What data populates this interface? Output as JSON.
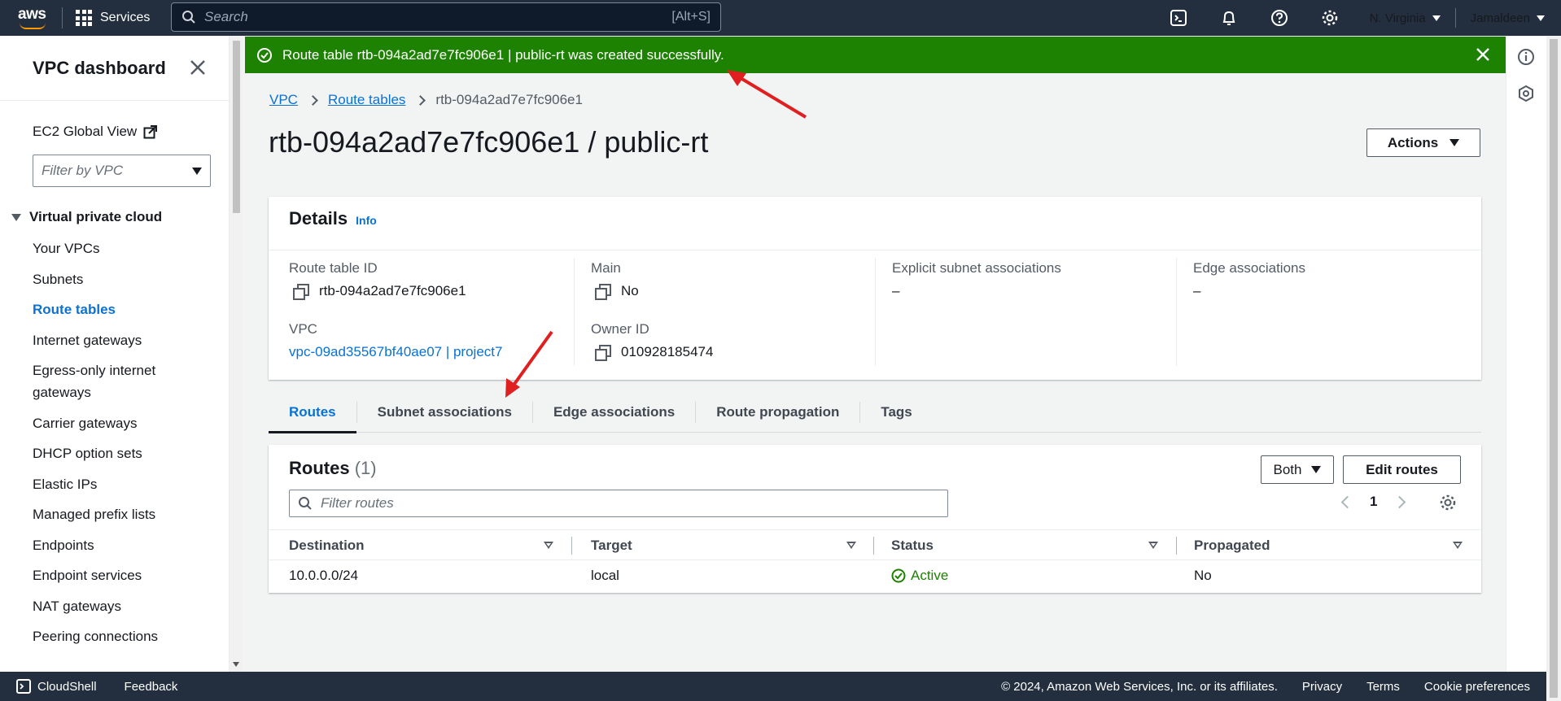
{
  "topnav": {
    "logo": "aws",
    "services_label": "Services",
    "search_placeholder": "Search",
    "search_shortcut": "[Alt+S]",
    "region": "N. Virginia",
    "user": "Jamaldeen",
    "icons": [
      "cloudshell-icon",
      "bell-icon",
      "help-icon",
      "gear-icon"
    ]
  },
  "sidebar": {
    "title": "VPC dashboard",
    "ec2_global_view": "EC2 Global View",
    "filter_placeholder": "Filter by VPC",
    "section": "Virtual private cloud",
    "items": [
      {
        "label": "Your VPCs"
      },
      {
        "label": "Subnets"
      },
      {
        "label": "Route tables",
        "active": true
      },
      {
        "label": "Internet gateways"
      },
      {
        "label": "Egress-only internet gateways"
      },
      {
        "label": "Carrier gateways"
      },
      {
        "label": "DHCP option sets"
      },
      {
        "label": "Elastic IPs"
      },
      {
        "label": "Managed prefix lists"
      },
      {
        "label": "Endpoints"
      },
      {
        "label": "Endpoint services"
      },
      {
        "label": "NAT gateways"
      },
      {
        "label": "Peering connections"
      }
    ]
  },
  "flash": {
    "message": "Route table rtb-094a2ad7e7fc906e1 | public-rt was created successfully.",
    "type": "success",
    "color": "#1d8102"
  },
  "breadcrumb": [
    "VPC",
    "Route tables",
    "rtb-094a2ad7e7fc906e1"
  ],
  "page_title": "rtb-094a2ad7e7fc906e1 / public-rt",
  "actions_label": "Actions",
  "details": {
    "heading": "Details",
    "info": "Info",
    "route_table_id_label": "Route table ID",
    "route_table_id": "rtb-094a2ad7e7fc906e1",
    "main_label": "Main",
    "main": "No",
    "explicit_label": "Explicit subnet associations",
    "explicit": "–",
    "edge_label": "Edge associations",
    "edge": "–",
    "vpc_label": "VPC",
    "vpc": "vpc-09ad35567bf40ae07 | project7",
    "owner_label": "Owner ID",
    "owner": "010928185474"
  },
  "tabs": [
    "Routes",
    "Subnet associations",
    "Edge associations",
    "Route propagation",
    "Tags"
  ],
  "routes": {
    "heading": "Routes",
    "count": "(1)",
    "both_label": "Both",
    "edit_label": "Edit routes",
    "filter_placeholder": "Filter routes",
    "page": "1",
    "columns": [
      "Destination",
      "Target",
      "Status",
      "Propagated"
    ],
    "rows": [
      {
        "destination": "10.0.0.0/24",
        "target": "local",
        "status": "Active",
        "propagated": "No"
      }
    ]
  },
  "footer": {
    "cloudshell": "CloudShell",
    "feedback": "Feedback",
    "copyright": "© 2024, Amazon Web Services, Inc. or its affiliates.",
    "links": [
      "Privacy",
      "Terms",
      "Cookie preferences"
    ]
  },
  "colors": {
    "nav_bg": "#232f3e",
    "link": "#0972d3",
    "success": "#1d8102",
    "annotation_arrow": "#e02020"
  }
}
